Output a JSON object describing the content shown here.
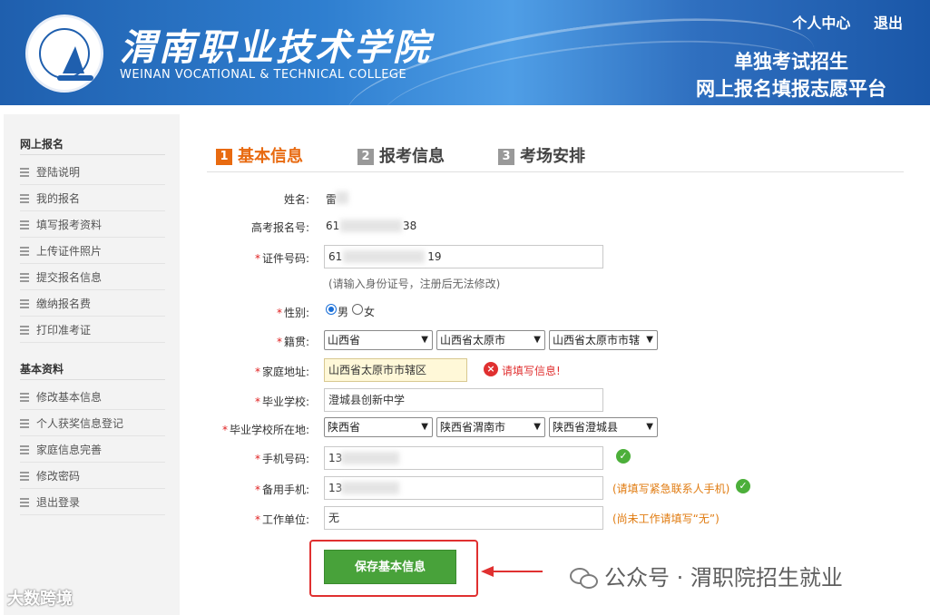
{
  "header": {
    "college_name": "渭南职业技术学院",
    "college_en": "WEINAN VOCATIONAL & TECHNICAL COLLEGE",
    "links": [
      "个人中心",
      "退出"
    ],
    "platform_line1": "单独考试招生",
    "platform_line2": "网上报名填报志愿平台"
  },
  "sidebar": {
    "group1_title": "网上报名",
    "group1_items": [
      "登陆说明",
      "我的报名",
      "填写报考资料",
      "上传证件照片",
      "提交报名信息",
      "缴纳报名费",
      "打印准考证"
    ],
    "group2_title": "基本资料",
    "group2_items": [
      "修改基本信息",
      "个人获奖信息登记",
      "家庭信息完善",
      "修改密码",
      "退出登录"
    ]
  },
  "tabs": [
    {
      "num": "1",
      "label": "基本信息",
      "active": true
    },
    {
      "num": "2",
      "label": "报考信息",
      "active": false
    },
    {
      "num": "3",
      "label": "考场安排",
      "active": false
    }
  ],
  "form": {
    "name_label": "姓名:",
    "name_value": "雷",
    "exam_no_label": "高考报名号:",
    "exam_no_value_start": "61",
    "exam_no_value_end": "38",
    "id_label": "证件号码:",
    "id_value_start": "61",
    "id_value_end": "19",
    "id_hint": "(请输入身份证号，注册后无法修改)",
    "gender_label": "性别:",
    "gender_options": [
      "男",
      "女"
    ],
    "gender_selected": "男",
    "native_label": "籍贯:",
    "native_selects": [
      "山西省",
      "山西省太原市",
      "山西省太原市市辖"
    ],
    "address_label": "家庭地址:",
    "address_value": "山西省太原市市辖区",
    "address_error": "请填写信息!",
    "school_label": "毕业学校:",
    "school_value": "澄城县创新中学",
    "school_loc_label": "毕业学校所在地:",
    "school_loc_selects": [
      "陕西省",
      "陕西省渭南市",
      "陕西省澄城县"
    ],
    "phone_label": "手机号码:",
    "phone_value_start": "13",
    "phone_value_end": "",
    "backup_phone_label": "备用手机:",
    "backup_phone_value_start": "13",
    "backup_phone_hint": "(请填写紧急联系人手机)",
    "work_label": "工作单位:",
    "work_value": "无",
    "work_hint": "(尚未工作请填写“无”)",
    "save_button": "保存基本信息"
  },
  "watermarks": {
    "right": "公众号 · 渭职院招生就业",
    "left": "大数跨境"
  },
  "colors": {
    "header_blue": "#1f5fae",
    "accent_orange": "#e86a10",
    "save_green": "#48a23a",
    "error_red": "#e03030",
    "ok_green": "#4caf3a"
  }
}
